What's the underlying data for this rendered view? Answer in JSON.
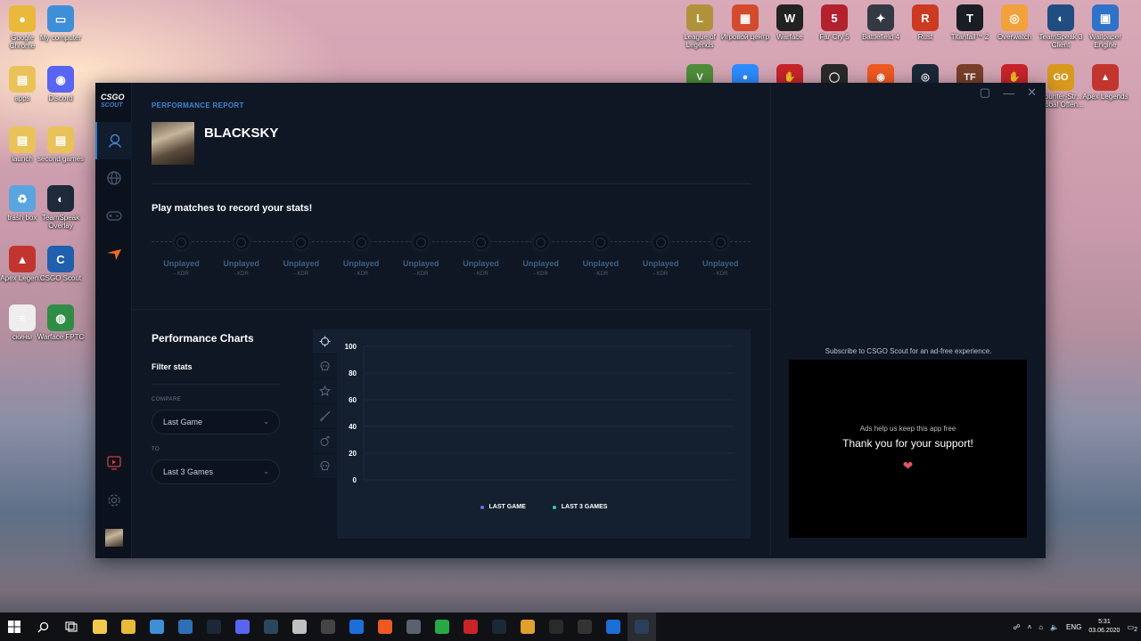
{
  "desktop": {
    "left_icons": [
      {
        "label": "Google Chrome",
        "color": "#e8b93a",
        "glyph": "●"
      },
      {
        "label": "My computer",
        "color": "#3f8ed8",
        "glyph": "▭"
      },
      {
        "label": "apps",
        "color": "#e9c35a",
        "glyph": "▤"
      },
      {
        "label": "Discord",
        "color": "#5865f2",
        "glyph": "◉"
      },
      {
        "label": "launch",
        "color": "#e9c35a",
        "glyph": "▤"
      },
      {
        "label": "second games",
        "color": "#e9c35a",
        "glyph": "▤"
      },
      {
        "label": "trash box",
        "color": "#5aa5e0",
        "glyph": "♻"
      },
      {
        "label": "TeamSpeak Overlay",
        "color": "#1e2a3a",
        "glyph": "◐"
      },
      {
        "label": "Apex Legen...",
        "color": "#c2352f",
        "glyph": "▲"
      },
      {
        "label": "CSGO Scout",
        "color": "#1f5fae",
        "glyph": "C"
      },
      {
        "label": "скины",
        "color": "#eeeeee",
        "glyph": "≡"
      },
      {
        "label": "Warface FPTC",
        "color": "#2f8d45",
        "glyph": "◍"
      }
    ],
    "top_icons": [
      {
        "label": "League of Legends",
        "color": "#b0923a",
        "glyph": "L"
      },
      {
        "label": "Игровой центр",
        "color": "#d34a2d",
        "glyph": "▦"
      },
      {
        "label": "Warface",
        "color": "#222222",
        "glyph": "W"
      },
      {
        "label": "Far Cry 5",
        "color": "#b3212f",
        "glyph": "5"
      },
      {
        "label": "Battlefield 4",
        "color": "#333a44",
        "glyph": "✦"
      },
      {
        "label": "Rust",
        "color": "#cc3a22",
        "glyph": "R"
      },
      {
        "label": "Titanfall™ 2",
        "color": "#1a1d24",
        "glyph": "T"
      },
      {
        "label": "Overwatch",
        "color": "#f3a13a",
        "glyph": "◎"
      },
      {
        "label": "TeamSpeak 3 Client",
        "color": "#1f4d80",
        "glyph": "◐"
      },
      {
        "label": "Wallpaper Engine",
        "color": "#2f72c7",
        "glyph": "▣"
      }
    ],
    "second_row_icons": [
      {
        "label": "",
        "color": "#4f8e3a",
        "glyph": "V"
      },
      {
        "label": "",
        "color": "#2d8cff",
        "glyph": "●"
      },
      {
        "label": "",
        "color": "#c8242a",
        "glyph": "✋"
      },
      {
        "label": "",
        "color": "#2a2a2a",
        "glyph": "◯"
      },
      {
        "label": "",
        "color": "#f05a22",
        "glyph": "◉"
      },
      {
        "label": "",
        "color": "#1b2838",
        "glyph": "◎"
      },
      {
        "label": "",
        "color": "#7a3f2a",
        "glyph": "TF"
      },
      {
        "label": "",
        "color": "#c8242a",
        "glyph": "✋"
      },
      {
        "label": "Counter-Str... Global Offen...",
        "color": "#d89a1e",
        "glyph": "GO"
      },
      {
        "label": "Apex Legends",
        "color": "#c2352f",
        "glyph": "▲"
      }
    ]
  },
  "app": {
    "logo_line1": "CSGO",
    "logo_line2": "SCOUT",
    "section_label": "PERFORMANCE REPORT",
    "player_name": "BLACKSKY",
    "play_message": "Play matches to record your stats!",
    "matches": [
      {
        "status": "Unplayed",
        "kdr": "- KDR"
      },
      {
        "status": "Unplayed",
        "kdr": "- KDR"
      },
      {
        "status": "Unplayed",
        "kdr": "- KDR"
      },
      {
        "status": "Unplayed",
        "kdr": "- KDR"
      },
      {
        "status": "Unplayed",
        "kdr": "- KDR"
      },
      {
        "status": "Unplayed",
        "kdr": "- KDR"
      },
      {
        "status": "Unplayed",
        "kdr": "- KDR"
      },
      {
        "status": "Unplayed",
        "kdr": "- KDR"
      },
      {
        "status": "Unplayed",
        "kdr": "- KDR"
      },
      {
        "status": "Unplayed",
        "kdr": "- KDR"
      }
    ],
    "perf_title": "Performance Charts",
    "filter_title": "Filter stats",
    "compare_label": "COMPARE",
    "compare_value": "Last Game",
    "to_label": "TO",
    "to_value": "Last 3 Games",
    "chart_tab_icons": [
      "crosshair-icon",
      "skull-headshot-icon",
      "star-icon",
      "knife-icon",
      "grenade-icon",
      "skull-icon"
    ],
    "ad_subscribe": "Subscribe to CSGO Scout for an ad-free experience.",
    "ad_small": "Ads help us keep this app free",
    "ad_big": "Thank you for your support!",
    "ad_heart": "❤",
    "colors": {
      "accent": "#2f7ad1",
      "orange": "#ff6a1a",
      "series1": "#6f6cf0",
      "series2": "#2bc7b7"
    }
  },
  "chart_data": {
    "type": "line",
    "y_ticks": [
      "100",
      "80",
      "60",
      "40",
      "20",
      "0"
    ],
    "ylim": [
      0,
      100
    ],
    "series": [
      {
        "name": "LAST GAME",
        "values": []
      },
      {
        "name": "LAST 3 GAMES",
        "values": []
      }
    ],
    "legend_position": "bottom",
    "grid": true
  },
  "taskbar": {
    "language": "ENG",
    "time": "5:31",
    "date": "03.06.2020",
    "notification_count": "2"
  }
}
